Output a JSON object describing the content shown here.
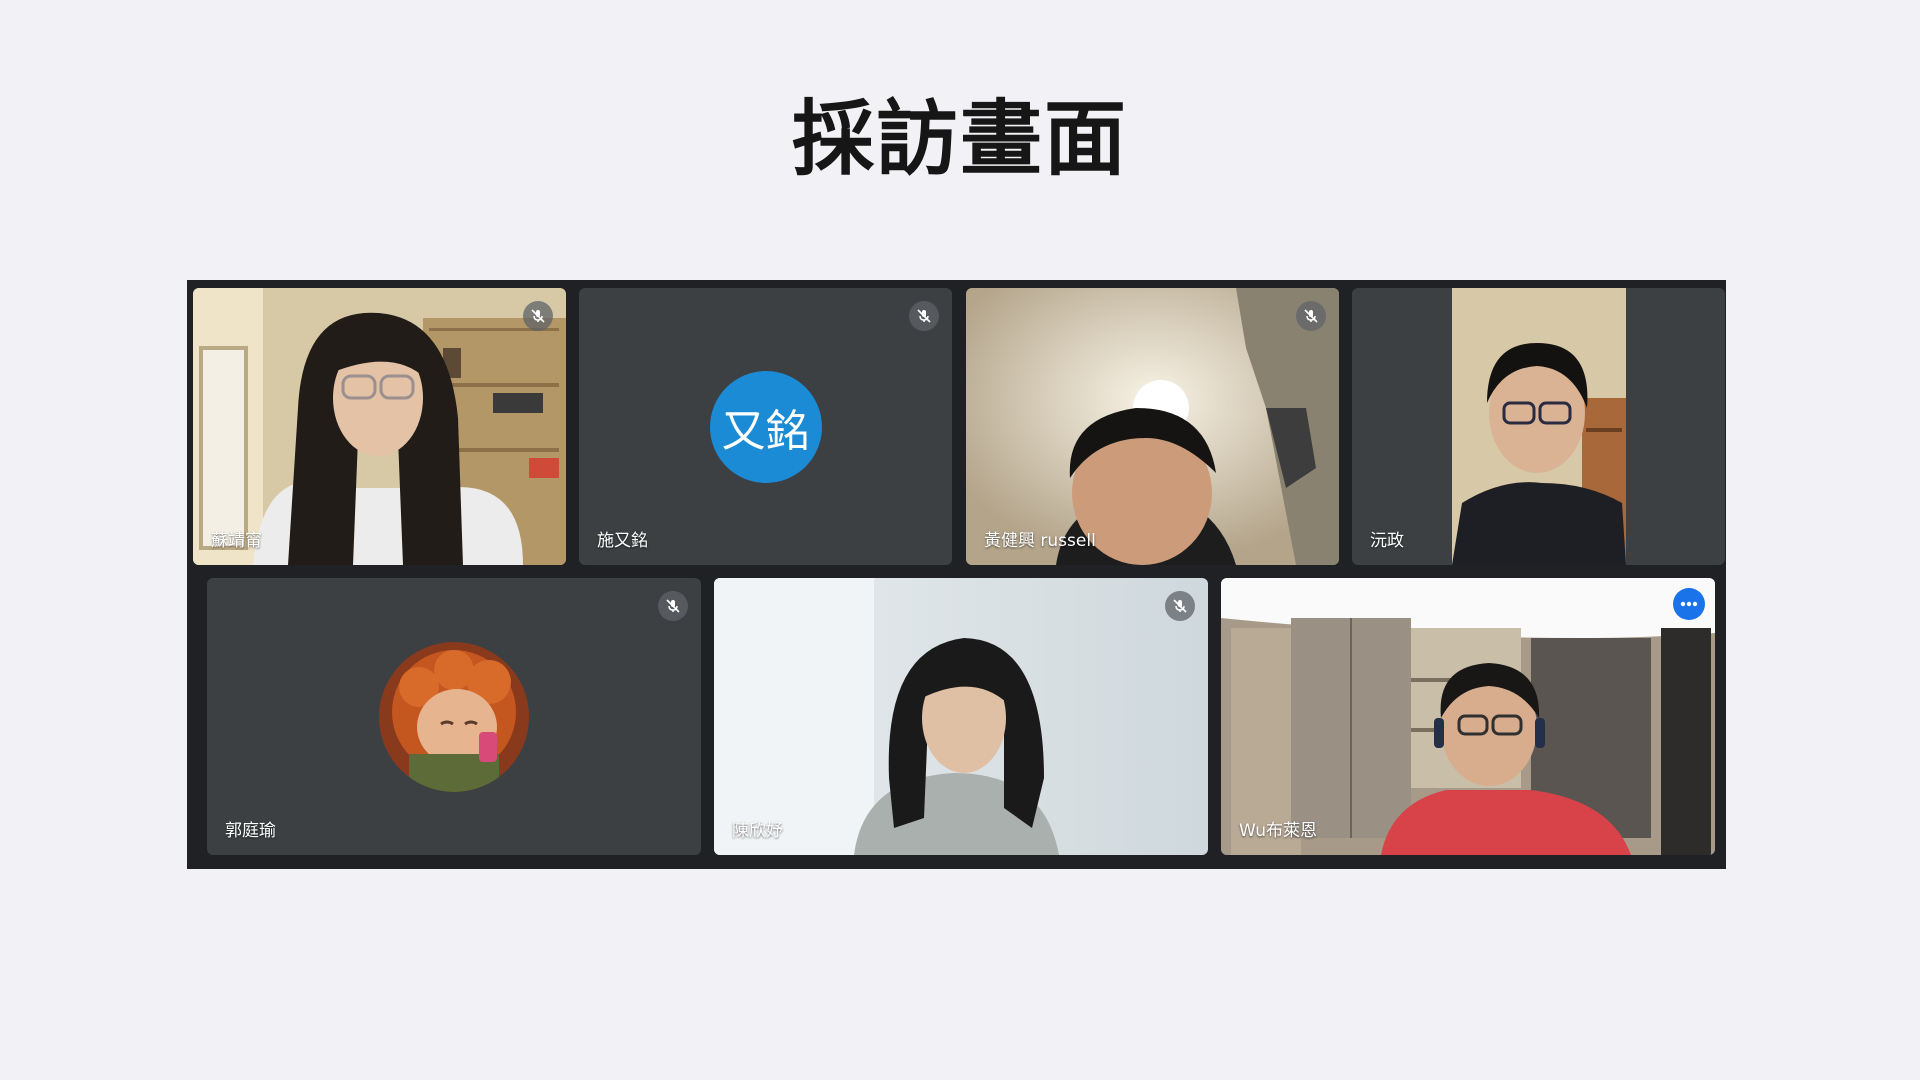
{
  "slide": {
    "title": "採訪畫面"
  },
  "meeting": {
    "participants": [
      {
        "name": "蘇靖甯",
        "muted": true
      },
      {
        "name": "施又銘",
        "muted": true,
        "avatar_text": "又銘",
        "avatar_color": "#1a8bd4"
      },
      {
        "name": "黃健興 russell",
        "muted": true
      },
      {
        "name": "沅政",
        "muted": false
      },
      {
        "name": "郭庭瑜",
        "muted": true
      },
      {
        "name": "陳欣妤",
        "muted": true
      },
      {
        "name": "Wu布萊恩",
        "muted": false,
        "active_speaker": true
      }
    ],
    "icons": {
      "mute": "mic-off-icon",
      "more": "more-options-icon"
    },
    "colors": {
      "tile_bg": "#3c4043",
      "grid_bg": "#202124",
      "accent": "#1a73e8"
    }
  }
}
